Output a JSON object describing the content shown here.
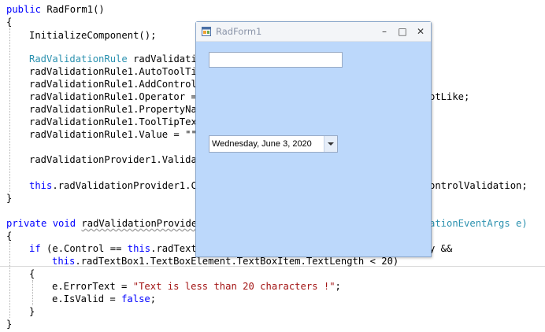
{
  "editor": {
    "line1": {
      "kw": "public",
      "rest": " RadForm1()"
    },
    "line2": {
      "text": "{"
    },
    "line3": {
      "text": "InitializeComponent();"
    },
    "line5": {
      "type": "RadValidationRule",
      "rest": " radValidatio"
    },
    "line6": {
      "text": "radValidationRule1.AutoToolTip"
    },
    "line7": {
      "text": "radValidationRule1.AddControl("
    },
    "line8": {
      "text": "radValidationRule1.Operator = ",
      "tail": "otLike;"
    },
    "line9": {
      "text": "radValidationRule1.PropertyNam"
    },
    "line10": {
      "text": "radValidationRule1.ToolTipText"
    },
    "line11": {
      "text": "radValidationRule1.Value = \"\";"
    },
    "line13": {
      "text": "radValidationProvider1.Validat"
    },
    "line15": {
      "kw": "this",
      "rest": ".radValidationProvider1.Co",
      "tail": "ontrolValidation;"
    },
    "line16": {
      "text": "}"
    },
    "line18": {
      "kw1": "private",
      "kw2": "void",
      "squiggle": "radValidationProvider",
      "tail": "ationEventArgs e)"
    },
    "line19": {
      "text": "{"
    },
    "line20": {
      "kw1": "if",
      "mid": " (e.Control == ",
      "kw2": "this",
      "rest": ".radTextB",
      "tail": "y &&"
    },
    "line21": {
      "kw": "this",
      "rest": ".radTextBox1.TextBoxElement.TextBoxItem.TextLength < 20)"
    },
    "line22": {
      "text": "{"
    },
    "line23": {
      "pre": "e.ErrorText = ",
      "str": "\"Text is less than 20 characters !\"",
      "post": ";"
    },
    "line24": {
      "pre": "e.IsValid = ",
      "kw": "false",
      "post": ";"
    },
    "line25": {
      "text": "}"
    },
    "line26": {
      "text": "}"
    }
  },
  "window": {
    "title": "RadForm1",
    "minimize_glyph": "–",
    "maximize_glyph": "□",
    "close_glyph": "✕",
    "textbox_value": "",
    "date_value": "Wednesday, June 3, 2020"
  },
  "colors": {
    "keyword": "#0000ff",
    "type": "#2b91af",
    "string": "#a31515",
    "form_background": "#bcd8fb"
  },
  "icons": [
    "app-form-icon",
    "minimize-icon",
    "maximize-icon",
    "close-icon",
    "dropdown-arrow-icon"
  ]
}
